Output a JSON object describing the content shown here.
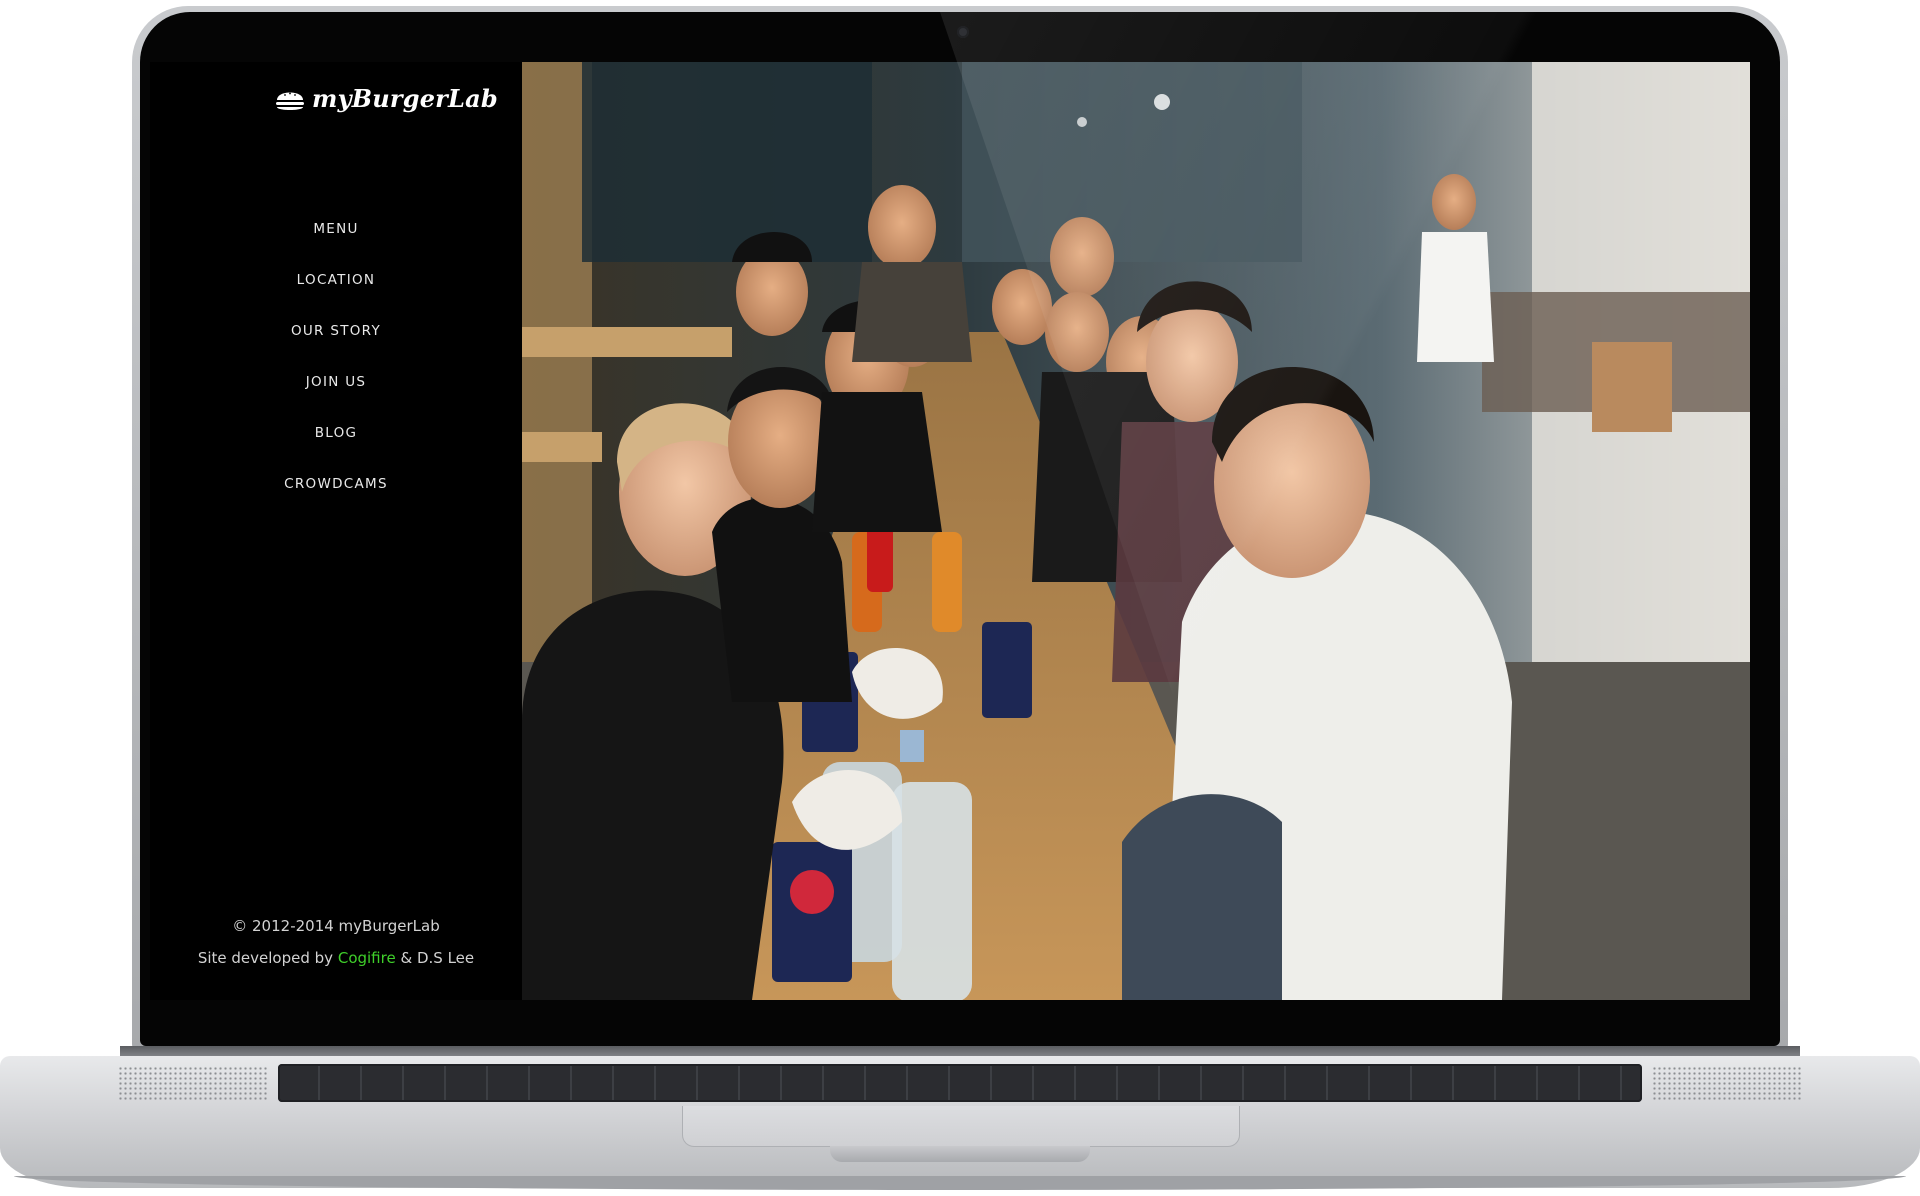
{
  "brand": {
    "name": "myBurgerLab"
  },
  "nav": {
    "items": [
      {
        "label": "MENU"
      },
      {
        "label": "LOCATION"
      },
      {
        "label": "OUR STORY"
      },
      {
        "label": "JOIN US"
      },
      {
        "label": "BLOG"
      },
      {
        "label": "CROWDCAMS"
      }
    ]
  },
  "footer": {
    "copyright": "© 2012-2014 myBurgerLab",
    "developed_prefix": "Site developed by",
    "developer_1": "Cogifire",
    "joiner": "&",
    "developer_2": "D.S Lee"
  },
  "slider": {
    "next_icon": "chevron-right-icon"
  },
  "colors": {
    "sidebar_bg": "#000000",
    "nav_text": "#e9e9e9",
    "accent_green": "#3fcf2a"
  }
}
